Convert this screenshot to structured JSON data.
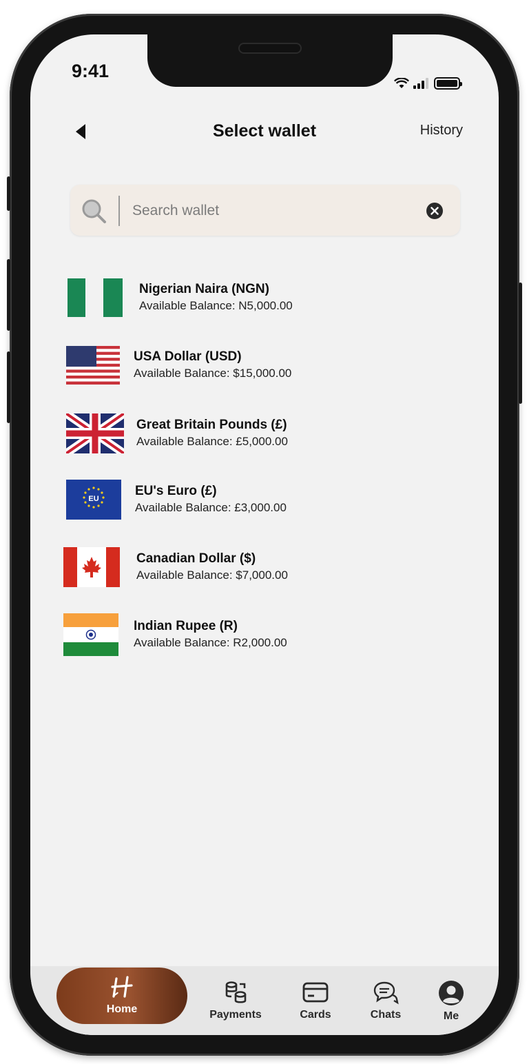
{
  "status_bar": {
    "time": "9:41"
  },
  "header": {
    "title": "Select wallet",
    "history_label": "History"
  },
  "search": {
    "placeholder": "Search wallet",
    "value": ""
  },
  "wallets": [
    {
      "name": "Nigerian Naira (NGN)",
      "balance": "Available Balance: N5,000.00",
      "flag": "nigeria-flag"
    },
    {
      "name": "USA Dollar (USD)",
      "balance": "Available Balance: $15,000.00",
      "flag": "usa-flag"
    },
    {
      "name": "Great Britain Pounds (£)",
      "balance": "Available Balance: £5,000.00",
      "flag": "uk-flag"
    },
    {
      "name": "EU's Euro (£)",
      "balance": "Available Balance: £3,000.00",
      "flag": "eu-flag",
      "flag_text": "EU"
    },
    {
      "name": "Canadian Dollar ($)",
      "balance": "Available Balance: $7,000.00",
      "flag": "canada-flag"
    },
    {
      "name": "Indian Rupee (R)",
      "balance": "Available Balance: R2,000.00",
      "flag": "india-flag"
    }
  ],
  "tabbar": {
    "home": "Home",
    "payments": "Payments",
    "cards": "Cards",
    "chats": "Chats",
    "me": "Me"
  },
  "colors": {
    "accent_gradient_start": "#7c3b1b",
    "accent_gradient_end": "#5a2a14",
    "background": "#f2f2f2",
    "search_bg": "#f2ece6"
  }
}
